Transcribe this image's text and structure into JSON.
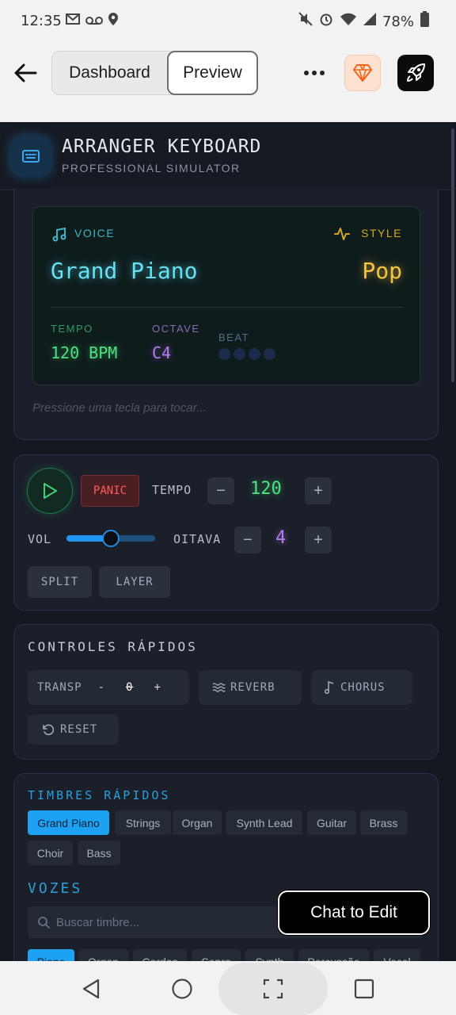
{
  "status_bar": {
    "time": "12:35",
    "battery": "78%",
    "icons": [
      "gmail-icon",
      "voicemail-icon",
      "location-icon",
      "mute-icon",
      "alarm-icon",
      "wifi-icon",
      "signal-icon",
      "battery-icon"
    ]
  },
  "header": {
    "tabs": [
      "Dashboard",
      "Preview"
    ],
    "selected_tab": "Preview"
  },
  "app": {
    "title": "ARRANGER KEYBOARD",
    "subtitle": "PROFESSIONAL SIMULATOR"
  },
  "display": {
    "voice_label": "VOICE",
    "voice_name": "Grand Piano",
    "style_label": "STYLE",
    "style_name": "Pop",
    "tempo_label": "TEMPO",
    "tempo_value": "120 BPM",
    "octave_label": "OCTAVE",
    "octave_value": "C4",
    "beat_label": "BEAT",
    "hint": "Pressione uma tecla para tocar..."
  },
  "transport": {
    "panic_label": "PANIC",
    "tempo_label": "TEMPO",
    "tempo_value": "120",
    "minus": "−",
    "plus": "+",
    "vol_label": "VOL",
    "volume": 0.5,
    "octave_label": "OITAVA",
    "octave_value": "4",
    "split_label": "SPLIT",
    "layer_label": "LAYER"
  },
  "quick_controls": {
    "title": "CONTROLES RÁPIDOS",
    "transp_label": "TRANSP",
    "transp_minus": "-",
    "transp_value": "0",
    "transp_plus": "+",
    "reverb_label": "REVERB",
    "chorus_label": "CHORUS",
    "reset_label": "RESET"
  },
  "timbres": {
    "title": "TIMBRES RÁPIDOS",
    "chips": [
      "Grand Piano",
      "Strings",
      "Organ",
      "Synth Lead",
      "Guitar",
      "Brass",
      "Choir",
      "Bass"
    ],
    "active": "Grand Piano",
    "vozes_title": "VOZES",
    "search_placeholder": "Buscar timbre...",
    "categories": [
      "Piano",
      "Organ",
      "Cordas",
      "Sopro",
      "Synth",
      "Percussão",
      "Vocal"
    ],
    "active_category": "Piano"
  },
  "chat_button": "Chat to Edit",
  "colors": {
    "voice": "#66e0f2",
    "style": "#f5c542",
    "tempo": "#4ee080",
    "octave": "#b57cf0",
    "accent": "#1da1f2",
    "panic": "#ff5a5a"
  }
}
